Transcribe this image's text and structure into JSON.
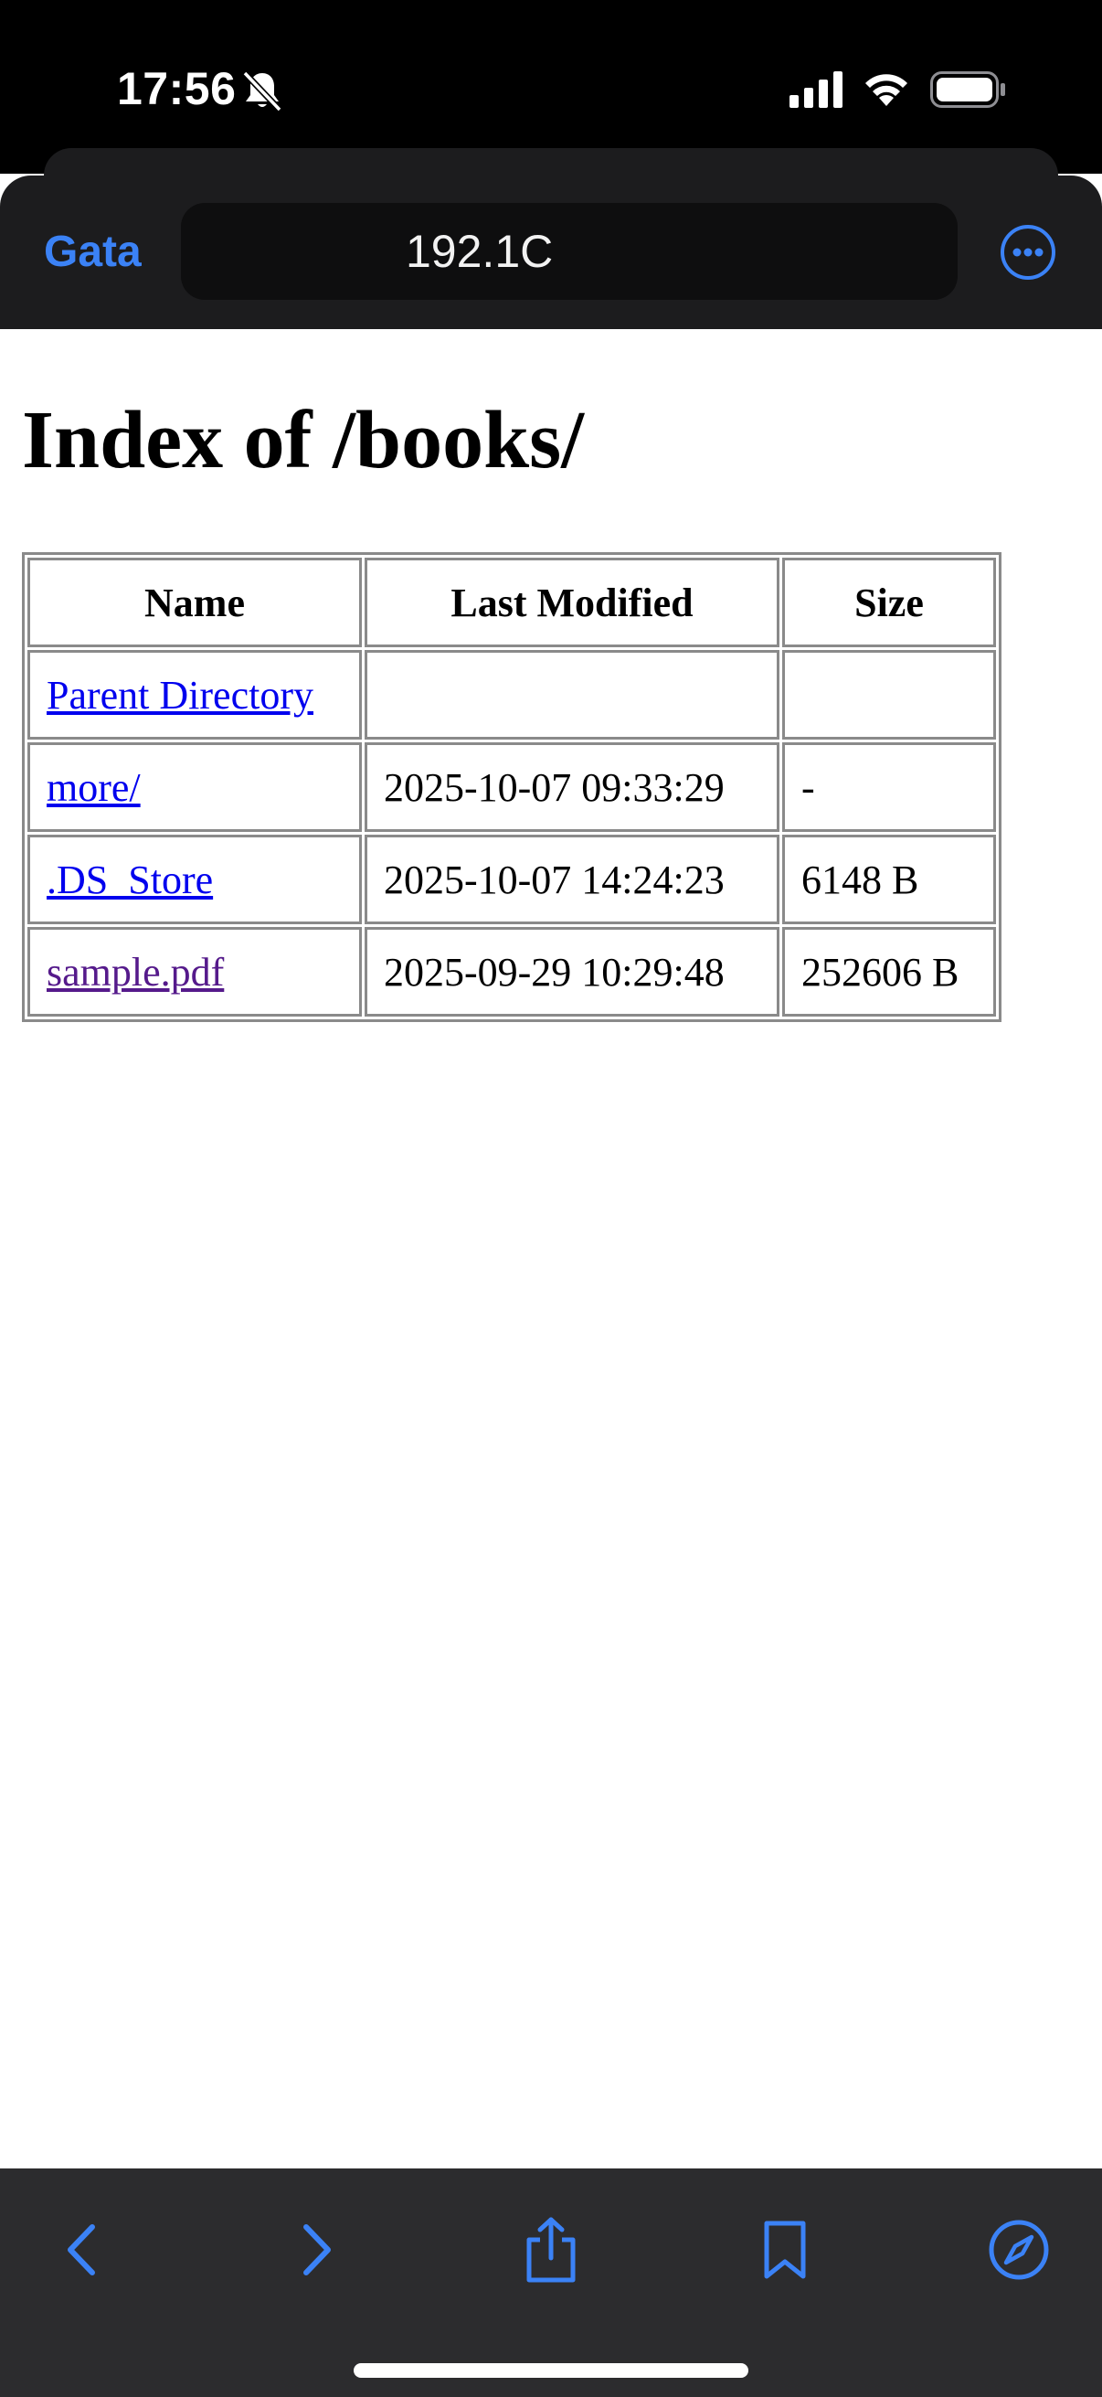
{
  "status_bar": {
    "time": "17:56",
    "icons": [
      "bell-slash-icon",
      "cellular-signal-icon",
      "wifi-icon",
      "battery-icon"
    ]
  },
  "browser": {
    "back_tab_label": "Gata",
    "address": "192.1C",
    "accent_color": "#3b82f6",
    "toolbar_icons": [
      "back-chevron-icon",
      "forward-chevron-icon",
      "share-icon",
      "bookmarks-icon",
      "compass-icon"
    ],
    "more_icon": "ellipsis-circle-icon"
  },
  "page": {
    "title": "Index of /books/",
    "table": {
      "headers": [
        "Name",
        "Last Modified",
        "Size"
      ],
      "rows": [
        {
          "name": "Parent Directory",
          "modified": "",
          "size": "",
          "visited": false
        },
        {
          "name": "more/",
          "modified": "2025-10-07 09:33:29",
          "size": "-",
          "visited": false
        },
        {
          "name": ".DS_Store",
          "modified": "2025-10-07 14:24:23",
          "size": "6148 B",
          "visited": false
        },
        {
          "name": "sample.pdf",
          "modified": "2025-09-29 10:29:48",
          "size": "252606 B",
          "visited": true
        }
      ]
    }
  }
}
